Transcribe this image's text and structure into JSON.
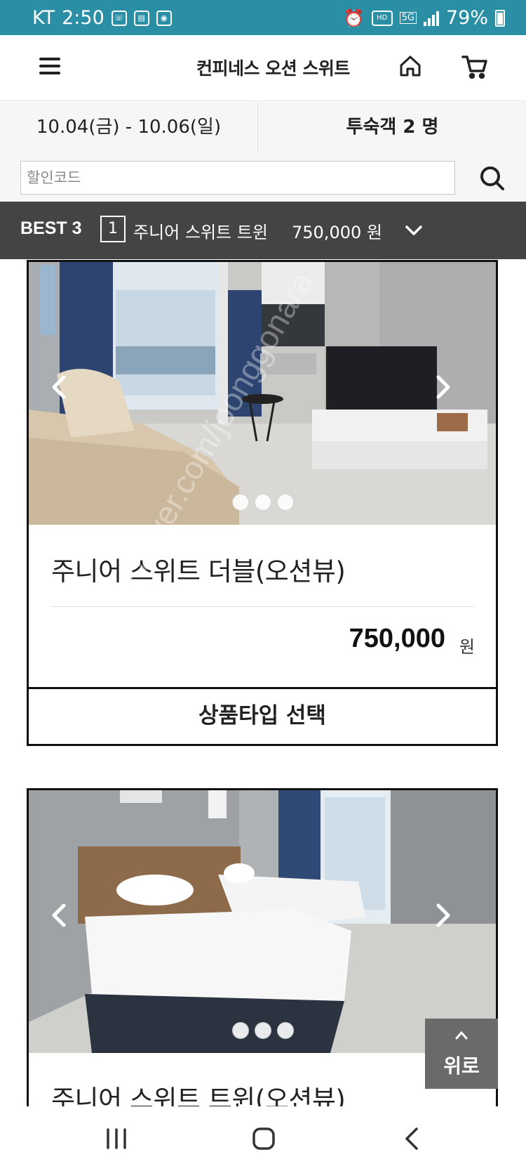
{
  "status_bar": {
    "carrier": "KT",
    "time": "2:50",
    "battery": "79%",
    "hd_label": "HD",
    "network": "5G"
  },
  "header": {
    "title": "컨피네스 오션 스위트",
    "menu_icon": "hamburger-menu-icon",
    "home_icon": "home-icon",
    "cart_icon": "cart-icon"
  },
  "booking": {
    "dates": "10.04(금) - 10.06(일)",
    "guests": "투숙객 2 명"
  },
  "coupon": {
    "placeholder": "할인코드",
    "search_icon": "search-icon"
  },
  "best_bar": {
    "label": "BEST 3",
    "rank": "1",
    "room": "주니어 스위트 트윈",
    "price": "750,000 원"
  },
  "rooms": [
    {
      "name": "주니어 스위트 더블(오션뷰)",
      "price": "750,000",
      "currency": "원",
      "select_label": "상품타입 선택",
      "slides": 3,
      "active_slide": 1
    },
    {
      "name": "주니어 스위트 트윈(오션뷰)",
      "slides": 3,
      "active_slide": 1
    }
  ],
  "scroll_top": {
    "label": "위로"
  },
  "watermark": "cafe.naver.com/joonggonara",
  "colors": {
    "status_bar": "#2a8fa5",
    "best_bar": "#444444",
    "card_border": "#111111"
  }
}
